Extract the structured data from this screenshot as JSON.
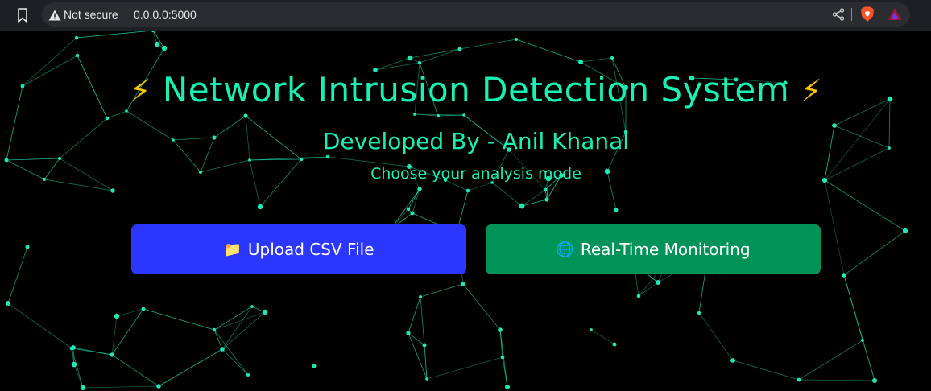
{
  "browser": {
    "security_label": "Not secure",
    "url": "0.0.0.0:5000"
  },
  "hero": {
    "bolt_left": "⚡",
    "title": "Network Intrusion Detection System",
    "bolt_right": "⚡",
    "subtitle": "Developed By - Anil Khanal",
    "prompt": "Choose your analysis mode"
  },
  "buttons": {
    "upload": {
      "emoji": "📁",
      "label": "Upload CSV File",
      "color": "#2b36ff"
    },
    "realtime": {
      "emoji": "🌐",
      "label": "Real-Time Monitoring",
      "color": "#009358"
    }
  },
  "theme": {
    "background": "#000000",
    "accent": "#19f0b4",
    "network_line": "#1de9b6"
  },
  "icons": [
    "bookmark-icon",
    "warning-icon",
    "share-icon",
    "brave-shield-icon",
    "brave-rewards-icon"
  ]
}
